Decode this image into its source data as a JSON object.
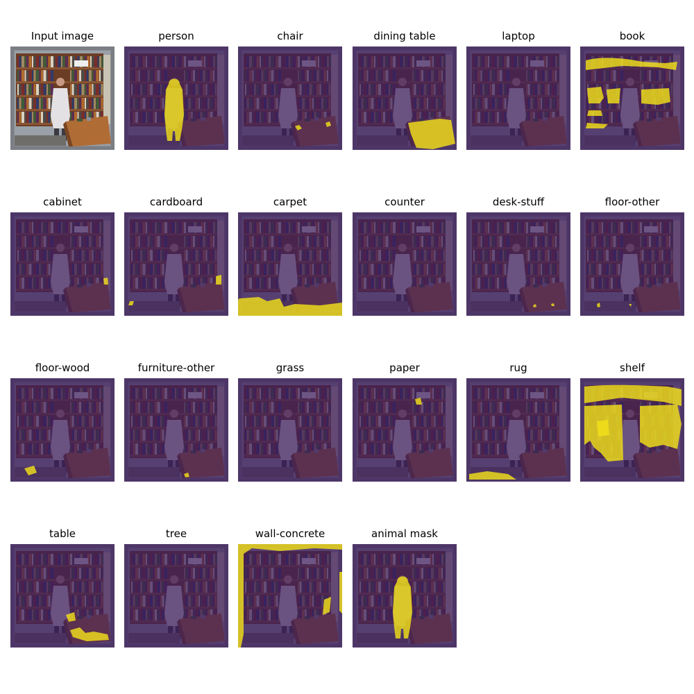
{
  "panels": [
    {
      "title": "Input image",
      "kind": "input"
    },
    {
      "title": "person",
      "kind": "mask",
      "mask": "person"
    },
    {
      "title": "chair",
      "kind": "mask",
      "mask": "chair"
    },
    {
      "title": "dining table",
      "kind": "mask",
      "mask": "dining-table"
    },
    {
      "title": "laptop",
      "kind": "mask",
      "mask": "none"
    },
    {
      "title": "book",
      "kind": "mask",
      "mask": "book"
    },
    {
      "title": "cabinet",
      "kind": "mask",
      "mask": "cabinet"
    },
    {
      "title": "cardboard",
      "kind": "mask",
      "mask": "cardboard"
    },
    {
      "title": "carpet",
      "kind": "mask",
      "mask": "carpet"
    },
    {
      "title": "counter",
      "kind": "mask",
      "mask": "none"
    },
    {
      "title": "desk-stuff",
      "kind": "mask",
      "mask": "desk-stuff"
    },
    {
      "title": "floor-other",
      "kind": "mask",
      "mask": "floor-other"
    },
    {
      "title": "floor-wood",
      "kind": "mask",
      "mask": "floor-wood"
    },
    {
      "title": "furniture-other",
      "kind": "mask",
      "mask": "furniture-other"
    },
    {
      "title": "grass",
      "kind": "mask",
      "mask": "none"
    },
    {
      "title": "paper",
      "kind": "mask",
      "mask": "paper"
    },
    {
      "title": "rug",
      "kind": "mask",
      "mask": "rug"
    },
    {
      "title": "shelf",
      "kind": "mask",
      "mask": "shelf"
    },
    {
      "title": "table",
      "kind": "mask",
      "mask": "table"
    },
    {
      "title": "tree",
      "kind": "mask",
      "mask": "none"
    },
    {
      "title": "wall-concrete",
      "kind": "mask",
      "mask": "wall-concrete"
    },
    {
      "title": "animal mask",
      "kind": "mask",
      "mask": "person"
    }
  ],
  "colors": {
    "overlay": "#3b1a5c",
    "mask": "#f2e11a",
    "frame": "#777a80"
  }
}
